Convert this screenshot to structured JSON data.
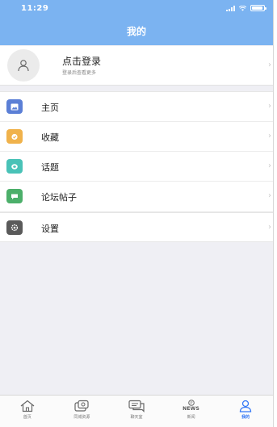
{
  "status_bar": {
    "time": "11:29"
  },
  "nav": {
    "title": "我的"
  },
  "login": {
    "title": "点击登录",
    "subtitle": "登录后查看更多"
  },
  "menu": {
    "items": [
      {
        "label": "主页",
        "icon": "home-card-icon",
        "color": "#5b7fd6"
      },
      {
        "label": "收藏",
        "icon": "favorites-icon",
        "color": "#f0b24b"
      },
      {
        "label": "话题",
        "icon": "topic-icon",
        "color": "#49c2b7"
      },
      {
        "label": "论坛帖子",
        "icon": "forum-post-icon",
        "color": "#4caf6a"
      }
    ]
  },
  "settings": {
    "label": "设置",
    "icon": "gear-icon",
    "color": "#5a5a5a"
  },
  "tabbar": {
    "tabs": [
      {
        "label": "首页",
        "icon": "home-icon",
        "active": false
      },
      {
        "label": "同城资源",
        "icon": "city-resource-icon",
        "active": false
      },
      {
        "label": "聊天室",
        "icon": "chat-icon",
        "active": false
      },
      {
        "label": "新闻",
        "icon": "news-icon",
        "icon_text": "NEWS",
        "active": false
      },
      {
        "label": "我的",
        "icon": "profile-icon",
        "active": true
      }
    ]
  },
  "colors": {
    "header": "#7bb3f1",
    "active_tab": "#3478f6",
    "background": "#efeff4"
  }
}
